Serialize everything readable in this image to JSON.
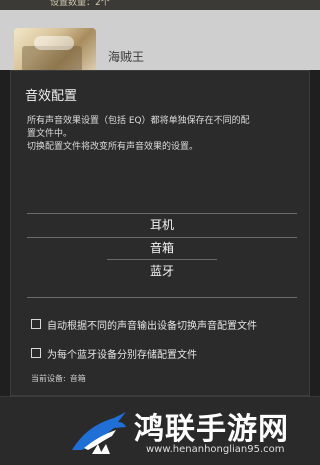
{
  "background": {
    "header_text": "设置数量：2个",
    "item_title": "海贼王"
  },
  "dialog": {
    "title": "音效配置",
    "description_lines": [
      "所有声音效果设置（包括 EQ）都将单独保存在不同的配",
      "置文件中。",
      "切换配置文件将改变所有声音效果的设置。"
    ],
    "options": [
      "耳机",
      "音箱",
      "蓝牙"
    ],
    "checkboxes": [
      {
        "label": "自动根据不同的声音输出设备切换声音配置文件",
        "checked": false
      },
      {
        "label": "为每个蓝牙设备分别存储配置文件",
        "checked": false
      }
    ],
    "current_device_label": "当前设备:",
    "current_device_value": "音箱"
  },
  "watermark": {
    "text": "鸿联手游网",
    "url": "www.henanhonglian95.com"
  },
  "colors": {
    "dialog_bg": "#2b2b2b",
    "overlay_bg": "#1f1f1f",
    "text": "#f0f0f0",
    "logo_blue": "#1f6fd6"
  }
}
